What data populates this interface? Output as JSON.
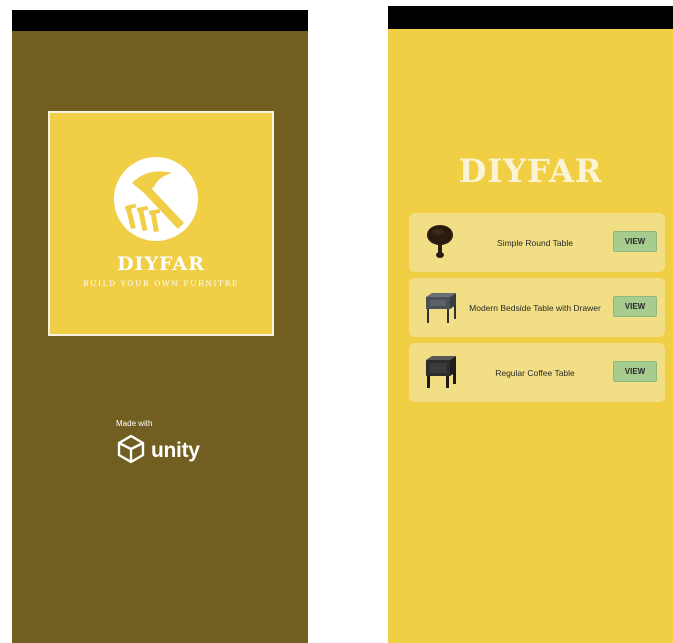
{
  "splash": {
    "brand": "DIYFAR",
    "tagline": "BUILD YOUR OWN FURNITRE",
    "made_with": "Made with",
    "engine": "unity",
    "colors": {
      "background": "#715e21",
      "card": "#f0cf46"
    },
    "icons": [
      "hammer-nails-icon",
      "unity-cube-icon"
    ]
  },
  "catalog": {
    "title": "DIYFAR",
    "colors": {
      "background": "#f1cf45",
      "row": "#f2de84",
      "button": "#a6cc8f"
    },
    "items": [
      {
        "name": "Simple Round Table",
        "button": "VIEW",
        "thumb": "round-table-thumbnail"
      },
      {
        "name": "Modern Bedside Table with Drawer",
        "button": "VIEW",
        "thumb": "bedside-table-thumbnail"
      },
      {
        "name": "Regular Coffee Table",
        "button": "VIEW",
        "thumb": "coffee-table-thumbnail"
      }
    ]
  }
}
